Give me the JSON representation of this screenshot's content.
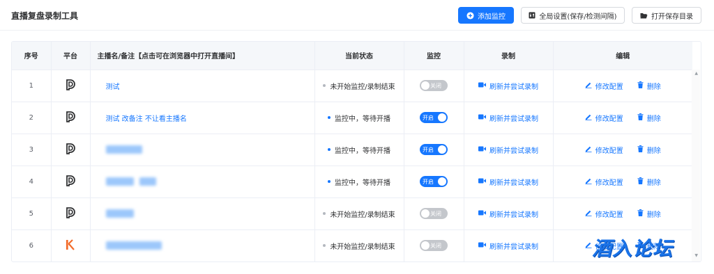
{
  "app": {
    "title": "直播复盘录制工具"
  },
  "toolbar": {
    "add_label": "添加监控",
    "settings_label": "全局设置(保存/检测间隔)",
    "folder_label": "打开保存目录"
  },
  "table": {
    "headers": {
      "index": "序号",
      "platform": "平台",
      "name": "主播名/备注【点击可在浏览器中打开直播间】",
      "status": "当前状态",
      "monitor": "监控",
      "record": "录制",
      "edit": "编辑"
    },
    "rows": [
      {
        "index": "1",
        "platform_icon": "douyin-icon",
        "name": "测试",
        "name_blurred": false,
        "status": "未开始监控/录制结束",
        "status_color": "#b4b8bf",
        "monitor_on": false,
        "switch_label": "关闭",
        "record_label": "刷新并尝试录制",
        "edit_label": "修改配置",
        "delete_label": "删除"
      },
      {
        "index": "2",
        "platform_icon": "douyin-icon",
        "name": "测试 改备注 不让看主播名",
        "name_blurred": false,
        "status": "监控中，等待开播",
        "status_color": "#1677ff",
        "monitor_on": true,
        "switch_label": "开启",
        "record_label": "刷新并尝试录制",
        "edit_label": "修改配置",
        "delete_label": "删除"
      },
      {
        "index": "3",
        "platform_icon": "douyin-icon",
        "name": "",
        "name_blurred": true,
        "status": "监控中，等待开播",
        "status_color": "#1677ff",
        "monitor_on": true,
        "switch_label": "开启",
        "record_label": "刷新并尝试录制",
        "edit_label": "修改配置",
        "delete_label": "删除"
      },
      {
        "index": "4",
        "platform_icon": "douyin-icon",
        "name": "",
        "name_blurred": true,
        "status": "监控中，等待开播",
        "status_color": "#1677ff",
        "monitor_on": true,
        "switch_label": "开启",
        "record_label": "刷新并尝试录制",
        "edit_label": "修改配置",
        "delete_label": "删除"
      },
      {
        "index": "5",
        "platform_icon": "douyin-icon",
        "name": "",
        "name_blurred": true,
        "status": "未开始监控/录制结束",
        "status_color": "#b4b8bf",
        "monitor_on": false,
        "switch_label": "关闭",
        "record_label": "刷新并尝试录制",
        "edit_label": "修改配置",
        "delete_label": "删除"
      },
      {
        "index": "6",
        "platform_icon": "kuaishou-icon",
        "name": "",
        "name_blurred": true,
        "status": "未开始监控/录制结束",
        "status_color": "#b4b8bf",
        "monitor_on": false,
        "switch_label": "关闭",
        "record_label": "刷新并尝试录制",
        "edit_label": "修改配置",
        "delete_label": "删除"
      }
    ]
  },
  "watermark": {
    "text": "酒入论坛"
  },
  "colors": {
    "accent": "#1677ff",
    "kuaishou": "#f26b2a",
    "douyin": "#303133"
  }
}
